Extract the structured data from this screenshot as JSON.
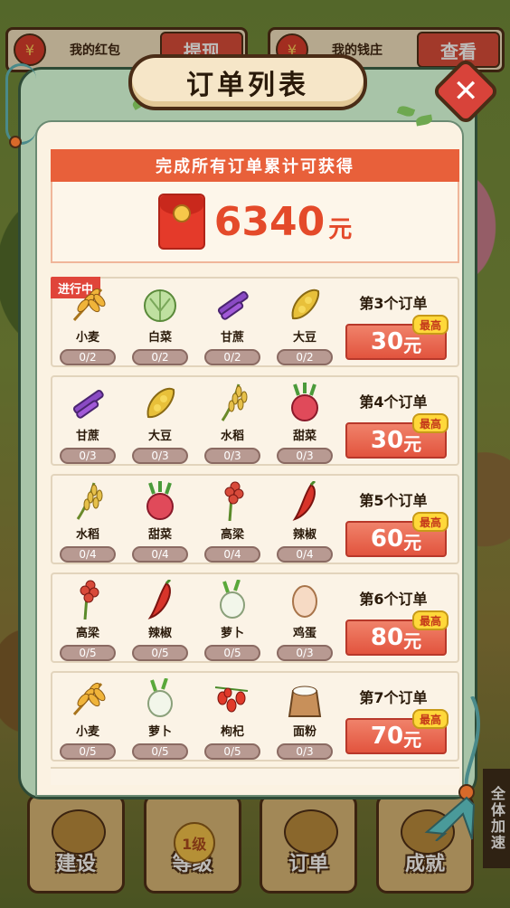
{
  "hud": {
    "left_label": "我的红包",
    "left_button": "提现",
    "right_label": "我的钱庄",
    "right_button": "查看"
  },
  "modal": {
    "title": "订单列表",
    "close_symbol": "✕",
    "reward_header": "完成所有订单累计可获得",
    "reward_amount": "6340",
    "reward_unit": "元"
  },
  "orders": [
    {
      "status": "进行中",
      "title": "第3个订单",
      "reward": "30",
      "unit": "元",
      "badge": "最高",
      "items": [
        {
          "name": "小麦",
          "progress": "0/2",
          "icon": "wheat-icon"
        },
        {
          "name": "白菜",
          "progress": "0/2",
          "icon": "cabbage-icon"
        },
        {
          "name": "甘蔗",
          "progress": "0/2",
          "icon": "sugarcane-icon"
        },
        {
          "name": "大豆",
          "progress": "0/2",
          "icon": "soybean-icon"
        }
      ]
    },
    {
      "title": "第4个订单",
      "reward": "30",
      "unit": "元",
      "badge": "最高",
      "items": [
        {
          "name": "甘蔗",
          "progress": "0/3",
          "icon": "sugarcane-icon"
        },
        {
          "name": "大豆",
          "progress": "0/3",
          "icon": "soybean-icon"
        },
        {
          "name": "水稻",
          "progress": "0/3",
          "icon": "rice-icon"
        },
        {
          "name": "甜菜",
          "progress": "0/3",
          "icon": "beet-icon"
        }
      ]
    },
    {
      "title": "第5个订单",
      "reward": "60",
      "unit": "元",
      "badge": "最高",
      "items": [
        {
          "name": "水稻",
          "progress": "0/4",
          "icon": "rice-icon"
        },
        {
          "name": "甜菜",
          "progress": "0/4",
          "icon": "beet-icon"
        },
        {
          "name": "高梁",
          "progress": "0/4",
          "icon": "sorghum-icon"
        },
        {
          "name": "辣椒",
          "progress": "0/4",
          "icon": "chili-icon"
        }
      ]
    },
    {
      "title": "第6个订单",
      "reward": "80",
      "unit": "元",
      "badge": "最高",
      "items": [
        {
          "name": "高梁",
          "progress": "0/5",
          "icon": "sorghum-icon"
        },
        {
          "name": "辣椒",
          "progress": "0/5",
          "icon": "chili-icon"
        },
        {
          "name": "萝卜",
          "progress": "0/5",
          "icon": "radish-icon"
        },
        {
          "name": "鸡蛋",
          "progress": "0/3",
          "icon": "egg-icon"
        }
      ]
    },
    {
      "title": "第7个订单",
      "reward": "70",
      "unit": "元",
      "badge": "最高",
      "items": [
        {
          "name": "小麦",
          "progress": "0/5",
          "icon": "wheat-icon"
        },
        {
          "name": "萝卜",
          "progress": "0/5",
          "icon": "radish-icon"
        },
        {
          "name": "枸杞",
          "progress": "0/5",
          "icon": "goji-icon"
        },
        {
          "name": "面粉",
          "progress": "0/3",
          "icon": "flour-icon"
        }
      ]
    }
  ],
  "nav": {
    "build": "建设",
    "level": "等级",
    "level_badge": "1级",
    "orders": "订单",
    "achievements": "成就"
  },
  "speed_tab": "全体加速",
  "colors": {
    "accent_red": "#e44a2a",
    "header_orange": "#e8603a",
    "modal_green": "#a8c4a8",
    "badge_yellow": "#ffd83a"
  }
}
